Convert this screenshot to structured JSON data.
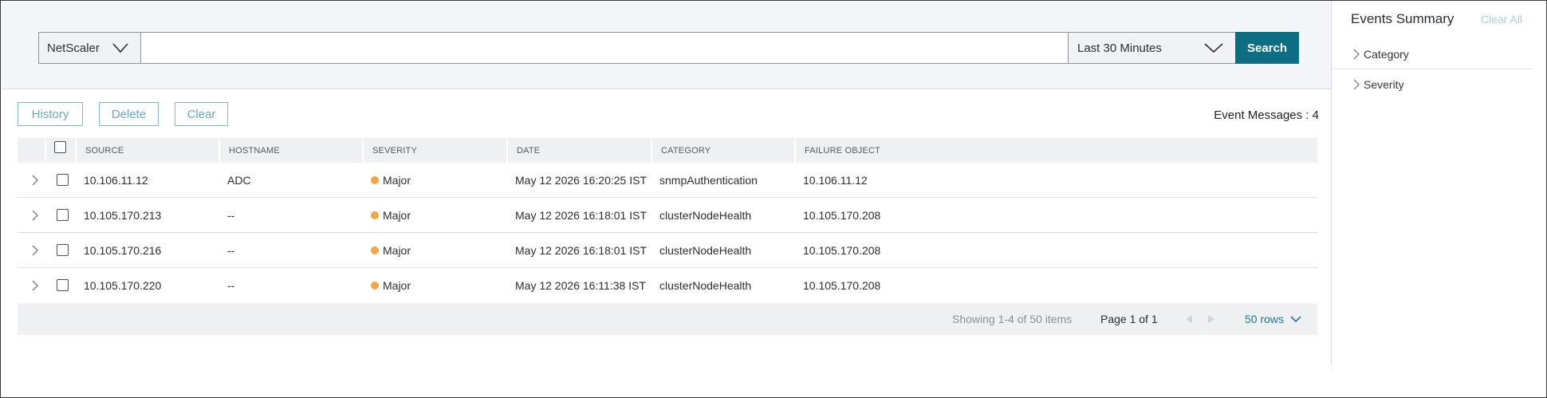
{
  "search": {
    "scope_label": "NetScaler",
    "query_value": "",
    "query_placeholder": "",
    "time_range_label": "Last 30 Minutes",
    "search_button": "Search"
  },
  "actions": {
    "history": "History",
    "delete": "Delete",
    "clear": "Clear"
  },
  "event_count_label": "Event Messages : 4",
  "table": {
    "columns": [
      "SOURCE",
      "HOSTNAME",
      "SEVERITY",
      "DATE",
      "CATEGORY",
      "FAILURE OBJECT"
    ],
    "rows": [
      {
        "source": "10.106.11.12",
        "hostname": "ADC",
        "severity": "Major",
        "date": "May 12 2026 16:20:25 IST",
        "category": "snmpAuthentication",
        "failure_object": "10.106.11.12"
      },
      {
        "source": "10.105.170.213",
        "hostname": "--",
        "severity": "Major",
        "date": "May 12 2026 16:18:01 IST",
        "category": "clusterNodeHealth",
        "failure_object": "10.105.170.208"
      },
      {
        "source": "10.105.170.216",
        "hostname": "--",
        "severity": "Major",
        "date": "May 12 2026 16:18:01 IST",
        "category": "clusterNodeHealth",
        "failure_object": "10.105.170.208"
      },
      {
        "source": "10.105.170.220",
        "hostname": "--",
        "severity": "Major",
        "date": "May 12 2026 16:11:38 IST",
        "category": "clusterNodeHealth",
        "failure_object": "10.105.170.208"
      }
    ],
    "footer": {
      "showing": "Showing 1-4 of 50 items",
      "page": "Page 1 of 1",
      "rows_per_page": "50 rows"
    }
  },
  "summary": {
    "title": "Events Summary",
    "clear_all": "Clear All",
    "facets": [
      "Category",
      "Severity"
    ]
  },
  "colors": {
    "primary": "#0d6e83",
    "severity_major": "#f7a442",
    "link": "#1d7a91"
  },
  "icons": [
    "chevron-down-icon",
    "chevron-right-icon",
    "checkbox-icon",
    "prev-page-icon",
    "next-page-icon"
  ]
}
